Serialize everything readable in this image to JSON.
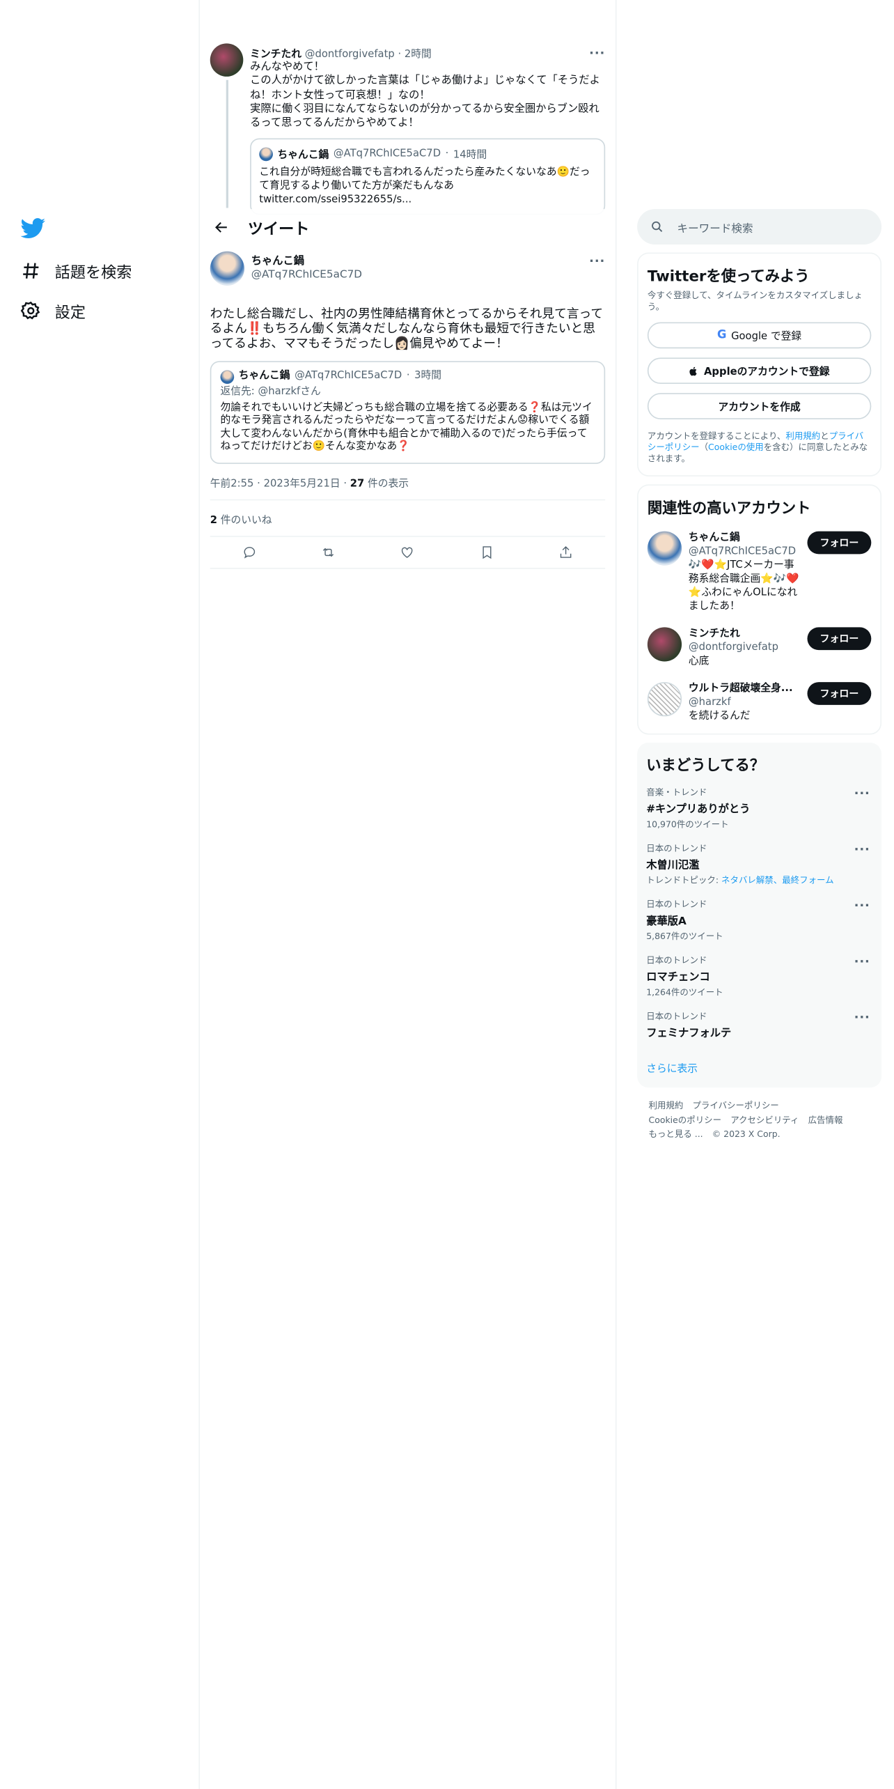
{
  "nav": {
    "items": [
      {
        "label": "話題を検索",
        "icon": "hashtag-icon"
      },
      {
        "label": "設定",
        "icon": "gear-icon"
      }
    ]
  },
  "prev_tweet": {
    "name": "ミンチたれ",
    "handle": "@dontforgivefatp",
    "time": "2時間",
    "lines": [
      "みんなやめて！",
      "この人がかけて欲しかった言葉は「じゃあ働けよ」じゃなくて「そうだよね！ホント女性って可哀想！」なの！",
      "実際に働く羽目になんてならないのが分かってるから安全圏からブン殴れるって思ってるんだからやめてよ！"
    ],
    "quote": {
      "name": "ちゃんこ鍋",
      "handle": "@ATq7RChICE5aC7D",
      "time": "14時間",
      "text": "これ自分が時短総合職でも言われるんだったら産みたくないなあ🙂だって育児するより働いてた方が楽だもんなあ",
      "link": "twitter.com/ssei95322655/s..."
    }
  },
  "header": {
    "title": "ツイート"
  },
  "main_tweet": {
    "name": "ちゃんこ鍋",
    "handle": "@ATq7RChICE5aC7D",
    "text": "わたし総合職だし、社内の男性陣結構育休とってるからそれ見て言ってるよん‼️もちろん働く気満々だしなんなら育休も最短で行きたいと思ってるよお、ママもそうだったし👩🏻偏見やめてよー！",
    "quote": {
      "name": "ちゃんこ鍋",
      "handle": "@ATq7RChICE5aC7D",
      "time": "3時間",
      "reply_to_prefix": "返信先: ",
      "reply_to": "@harzkfさん",
      "text": "勿論それでもいいけど夫婦どっちも総合職の立場を捨てる必要ある❓私は元ツイ的なモラ発言されるんだったらやだなーって言ってるだけだよん😟稼いでくる額大して変わんないんだから(育休中も組合とかで補助入るので)だったら手伝ってねってだけだけどお🙂そんな変かなあ❓"
    },
    "time": "午前2:55",
    "date": "2023年5月21日",
    "views_count": "27",
    "views_label": " 件の表示",
    "likes_count": "2",
    "likes_label": " 件のいいね"
  },
  "search": {
    "placeholder": "キーワード検索"
  },
  "signup": {
    "title": "Twitterを使ってみよう",
    "subtitle": "今すぐ登録して、タイムラインをカスタマイズしましょう。",
    "google_label": "Google で登録",
    "apple_label": "Appleのアカウントで登録",
    "create_label": "アカウントを作成",
    "legal_1": "アカウントを登録することにより、",
    "legal_terms": "利用規約",
    "legal_and": "と",
    "legal_privacy": "プライバシーポリシー",
    "legal_paren_open": "（",
    "legal_cookie": "Cookieの使用",
    "legal_2": "を含む）に同意したとみなされます。"
  },
  "related": {
    "title": "関連性の高いアカウント",
    "follow_label": "フォロー",
    "accounts": [
      {
        "name": "ちゃんこ鍋",
        "handle": "@ATq7RChICE5aC7D",
        "bio": "🎶❤️⭐JTCメーカー事務系総合職企画⭐🎶❤️⭐ふわにゃんOLになれましたあ！"
      },
      {
        "name": "ミンチたれ",
        "handle": "@dontforgivefatp",
        "bio": "心底"
      },
      {
        "name": "ウルトラ超破壊全身...",
        "handle": "@harzkf",
        "bio": "を続けるんだ"
      }
    ]
  },
  "trends": {
    "title": "いまどうしてる？",
    "items": [
      {
        "context": "音楽・トレンド",
        "name": "#キンプリありがとう",
        "count": "10,970件のツイート"
      },
      {
        "context": "日本のトレンド",
        "name": "木曽川氾濫",
        "count_prefix": "トレンドトピック: ",
        "count_links": "ネタバレ解禁、最終フォーム"
      },
      {
        "context": "日本のトレンド",
        "name": "豪華版A",
        "count": "5,867件のツイート"
      },
      {
        "context": "日本のトレンド",
        "name": "ロマチェンコ",
        "count": "1,264件のツイート"
      },
      {
        "context": "日本のトレンド",
        "name": "フェミナフォルテ"
      }
    ],
    "show_more": "さらに表示"
  },
  "footer": {
    "terms": "利用規約",
    "privacy": "プライバシーポリシー",
    "cookie": "Cookieのポリシー",
    "accessibility": "アクセシビリティ",
    "ads": "広告情報",
    "more": "もっと見る ...",
    "copyright": "© 2023 X Corp."
  },
  "colors": {
    "accent": "#1d9bf0",
    "text": "#0f1419",
    "muted": "#536471",
    "border": "#eff3f4"
  }
}
